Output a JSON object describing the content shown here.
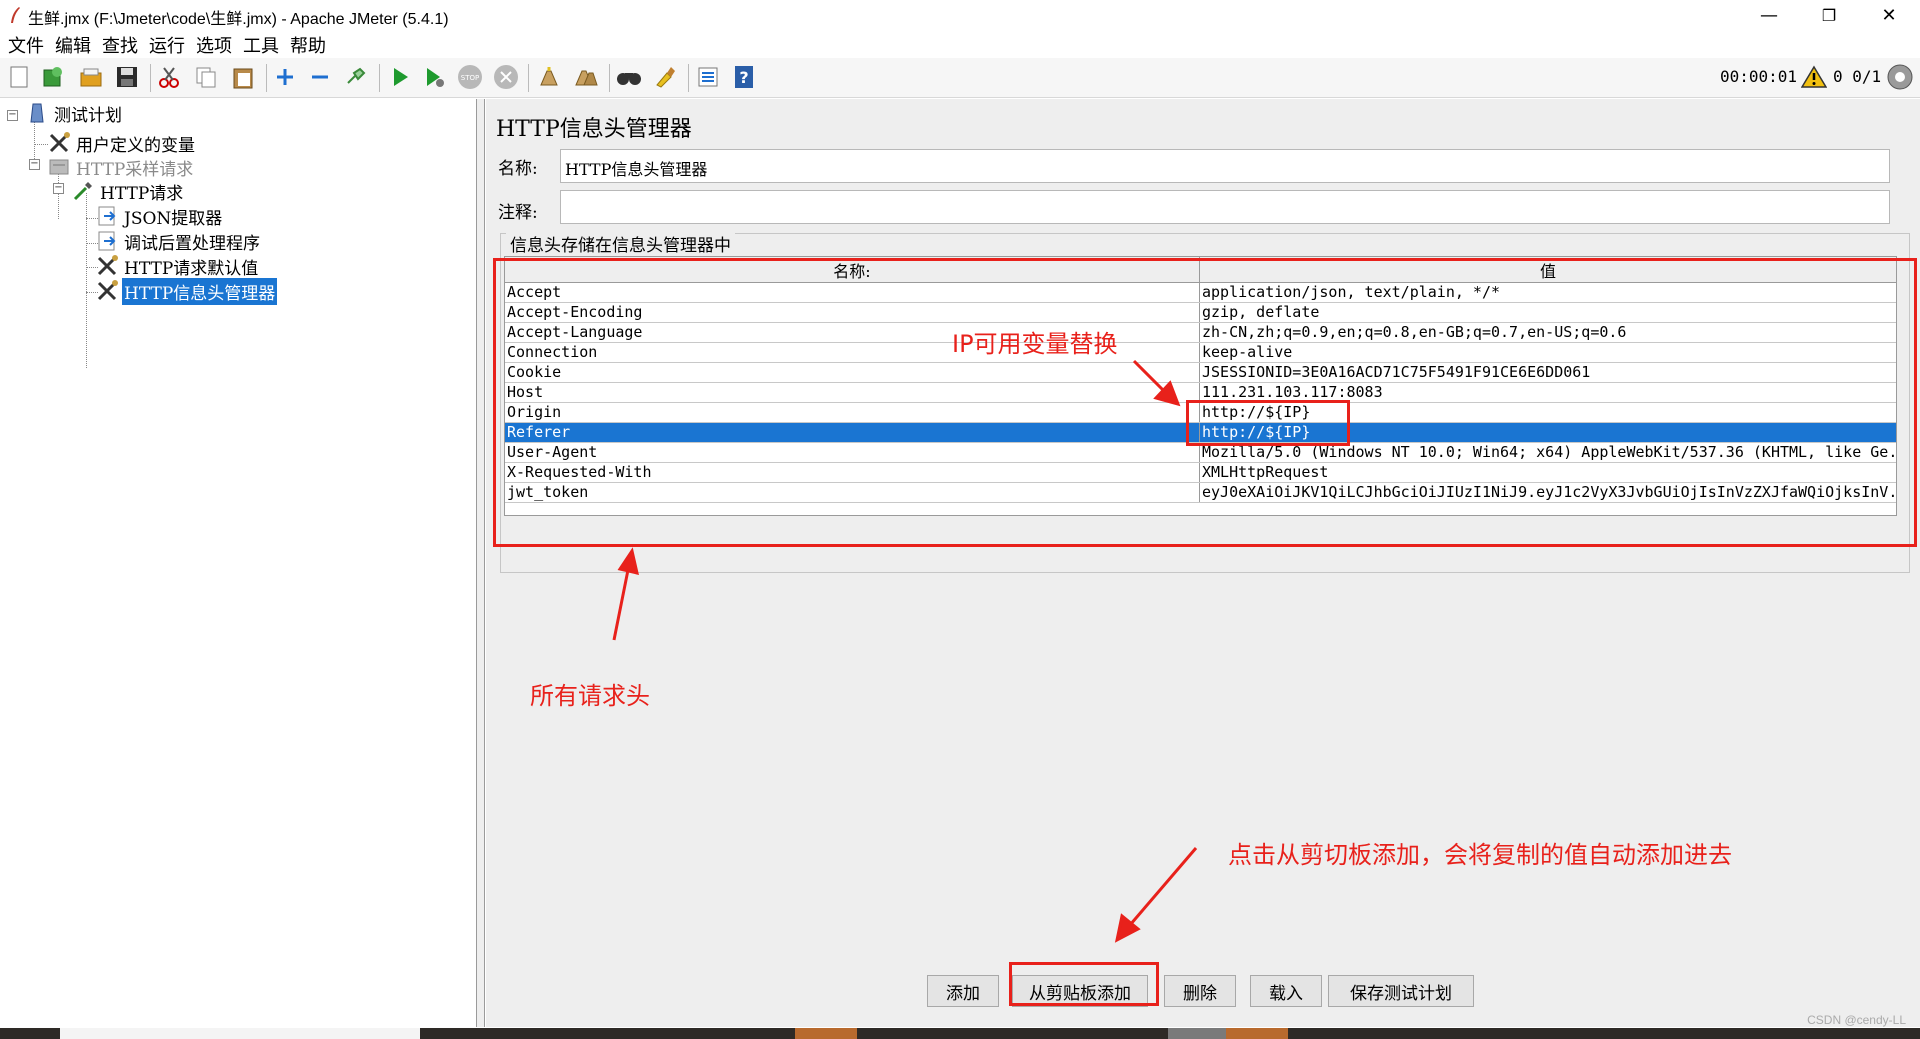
{
  "window": {
    "title": "生鲜.jmx (F:\\Jmeter\\code\\生鲜.jmx) - Apache JMeter (5.4.1)",
    "minimize": "—",
    "restore": "❐",
    "close": "✕"
  },
  "menu": [
    "文件",
    "编辑",
    "查找",
    "运行",
    "选项",
    "工具",
    "帮助"
  ],
  "toolbar": {
    "timer": "00:00:01",
    "warn_count": "0  0/1",
    "icons": [
      "new-icon",
      "templates-icon",
      "open-icon",
      "save-icon",
      "cut-icon",
      "copy-icon",
      "paste-icon",
      "expand-icon",
      "collapse-icon",
      "toggle-icon",
      "start-icon",
      "start-no-pause-icon",
      "stop-icon",
      "shutdown-icon",
      "clear-icon",
      "clear-all-icon",
      "search-icon",
      "reset-search-icon",
      "function-helper-icon",
      "help-icon",
      "warning-icon",
      "threads-icon"
    ]
  },
  "tree": {
    "nodes": [
      {
        "label": "测试计划"
      },
      {
        "label": "用户定义的变量"
      },
      {
        "label": "HTTP采样请求"
      },
      {
        "label": "HTTP请求"
      },
      {
        "label": "JSON提取器"
      },
      {
        "label": "调试后置处理程序"
      },
      {
        "label": "HTTP请求默认值"
      },
      {
        "label": "HTTP信息头管理器"
      }
    ]
  },
  "panel": {
    "title": "HTTP信息头管理器",
    "name_label": "名称:",
    "name_value": "HTTP信息头管理器",
    "comment_label": "注释:",
    "comment_value": "",
    "group_label": "信息头存储在信息头管理器中"
  },
  "table": {
    "headers": [
      "名称:",
      "值"
    ],
    "rows": [
      {
        "name": "Accept",
        "value": "application/json, text/plain, */*"
      },
      {
        "name": "Accept-Encoding",
        "value": "gzip, deflate"
      },
      {
        "name": "Accept-Language",
        "value": "zh-CN,zh;q=0.9,en;q=0.8,en-GB;q=0.7,en-US;q=0.6"
      },
      {
        "name": "Connection",
        "value": "keep-alive"
      },
      {
        "name": "Cookie",
        "value": "JSESSIONID=3E0A16ACD71C75F5491F91CE6E6DD061"
      },
      {
        "name": "Host",
        "value": "111.231.103.117:8083"
      },
      {
        "name": "Origin",
        "value": "http://${IP}"
      },
      {
        "name": "Referer",
        "value": "http://${IP}"
      },
      {
        "name": "User-Agent",
        "value": "Mozilla/5.0 (Windows NT 10.0; Win64; x64) AppleWebKit/537.36 (KHTML, like Ge..."
      },
      {
        "name": "X-Requested-With",
        "value": "XMLHttpRequest"
      },
      {
        "name": "jwt_token",
        "value": "eyJ0eXAiOiJKV1QiLCJhbGciOiJIUzI1NiJ9.eyJ1c2VyX3JvbGUiOjIsInVzZXJfaWQiOjksInV..."
      }
    ]
  },
  "buttons": {
    "add": "添加",
    "add_clipboard": "从剪贴板添加",
    "delete": "删除",
    "load": "载入",
    "save_plan": "保存测试计划"
  },
  "annotations": {
    "ip_note": "IP可用变量替换",
    "all_headers": "所有请求头",
    "clipboard_note": "点击从剪切板添加，会将复制的值自动添加进去"
  },
  "watermark": "CSDN @cendy-LL",
  "colors": {
    "selection": "#1a75d2",
    "annotation": "#e8211b"
  }
}
